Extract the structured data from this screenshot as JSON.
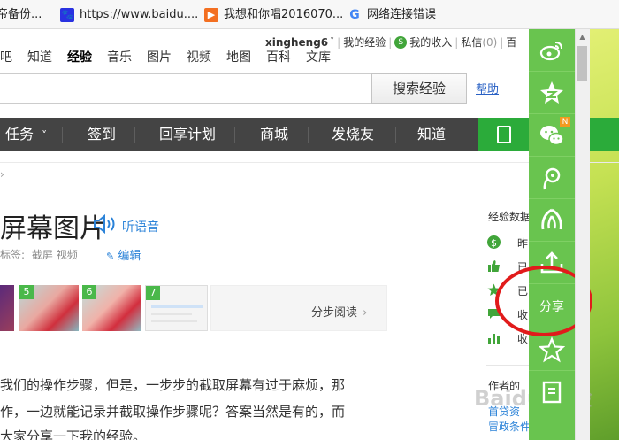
{
  "bookmarks": [
    {
      "label": "帝备份...",
      "icon": "bookmark-icon"
    },
    {
      "label": "https://www.baidu....",
      "icon": "baidu-paw-icon",
      "color": "#2932e1"
    },
    {
      "label": "我想和你唱2016070...",
      "icon": "video-icon",
      "color": "#f36f21"
    },
    {
      "label": "网络连接错误",
      "icon": "google-icon"
    }
  ],
  "userline": {
    "username": "xingheng6",
    "my_experience": "我的经验",
    "my_income": "我的收入",
    "messages": "私信",
    "messages_count": "(0)",
    "more": "百"
  },
  "nav": [
    "吧",
    "知道",
    "经验",
    "音乐",
    "图片",
    "视频",
    "地图",
    "百科",
    "文库"
  ],
  "nav_active": "经验",
  "search": {
    "button_label": "搜索经验",
    "help_label": "帮助",
    "value": ""
  },
  "menu": {
    "items": [
      "任务",
      "签到",
      "回享计划",
      "商城",
      "发烧友",
      "知道"
    ],
    "task_arrow": "˅"
  },
  "article": {
    "title": "屏幕图片",
    "listen_label": "听语音",
    "tags_label": "标签:",
    "tags": "截屏 视频",
    "edit_label": "编辑",
    "steps_label": "分步阅读",
    "thumb_numbers": [
      "5",
      "6",
      "7"
    ],
    "paragraphs": [
      "我们的操作步骤，但是，一步步的截取屏幕有过于麻烦，那",
      "作，一边就能记录并截取操作步骤呢？答案当然是有的，而",
      "大家分享一下我的经验。"
    ]
  },
  "sidebar": {
    "title": "经验数据",
    "rows": [
      {
        "icon": "dollar-icon",
        "label": "昨"
      },
      {
        "icon": "thumb-up-icon",
        "label": "已"
      },
      {
        "icon": "star-icon",
        "label": "已"
      },
      {
        "icon": "chat-icon",
        "label": "收"
      },
      {
        "icon": "bar-chart-icon",
        "label": "收"
      }
    ],
    "author_label": "作者的",
    "links": [
      "首贷资",
      "冒政条件"
    ]
  },
  "share_rail": {
    "buttons": [
      "weibo-icon",
      "qzone-icon",
      "wechat-icon",
      "tencent-weibo-icon",
      "renren-icon",
      "upload-icon",
      "share",
      "favorite-icon",
      "report-icon"
    ],
    "share_label": "分享",
    "badge": "N"
  },
  "watermark": "Baidu 经验",
  "colors": {
    "rail_green": "#69c44f",
    "menu_dark": "#444444",
    "menu_green": "#2bab3a",
    "link_blue": "#2c83d8",
    "annotation_red": "#e11b1b"
  }
}
